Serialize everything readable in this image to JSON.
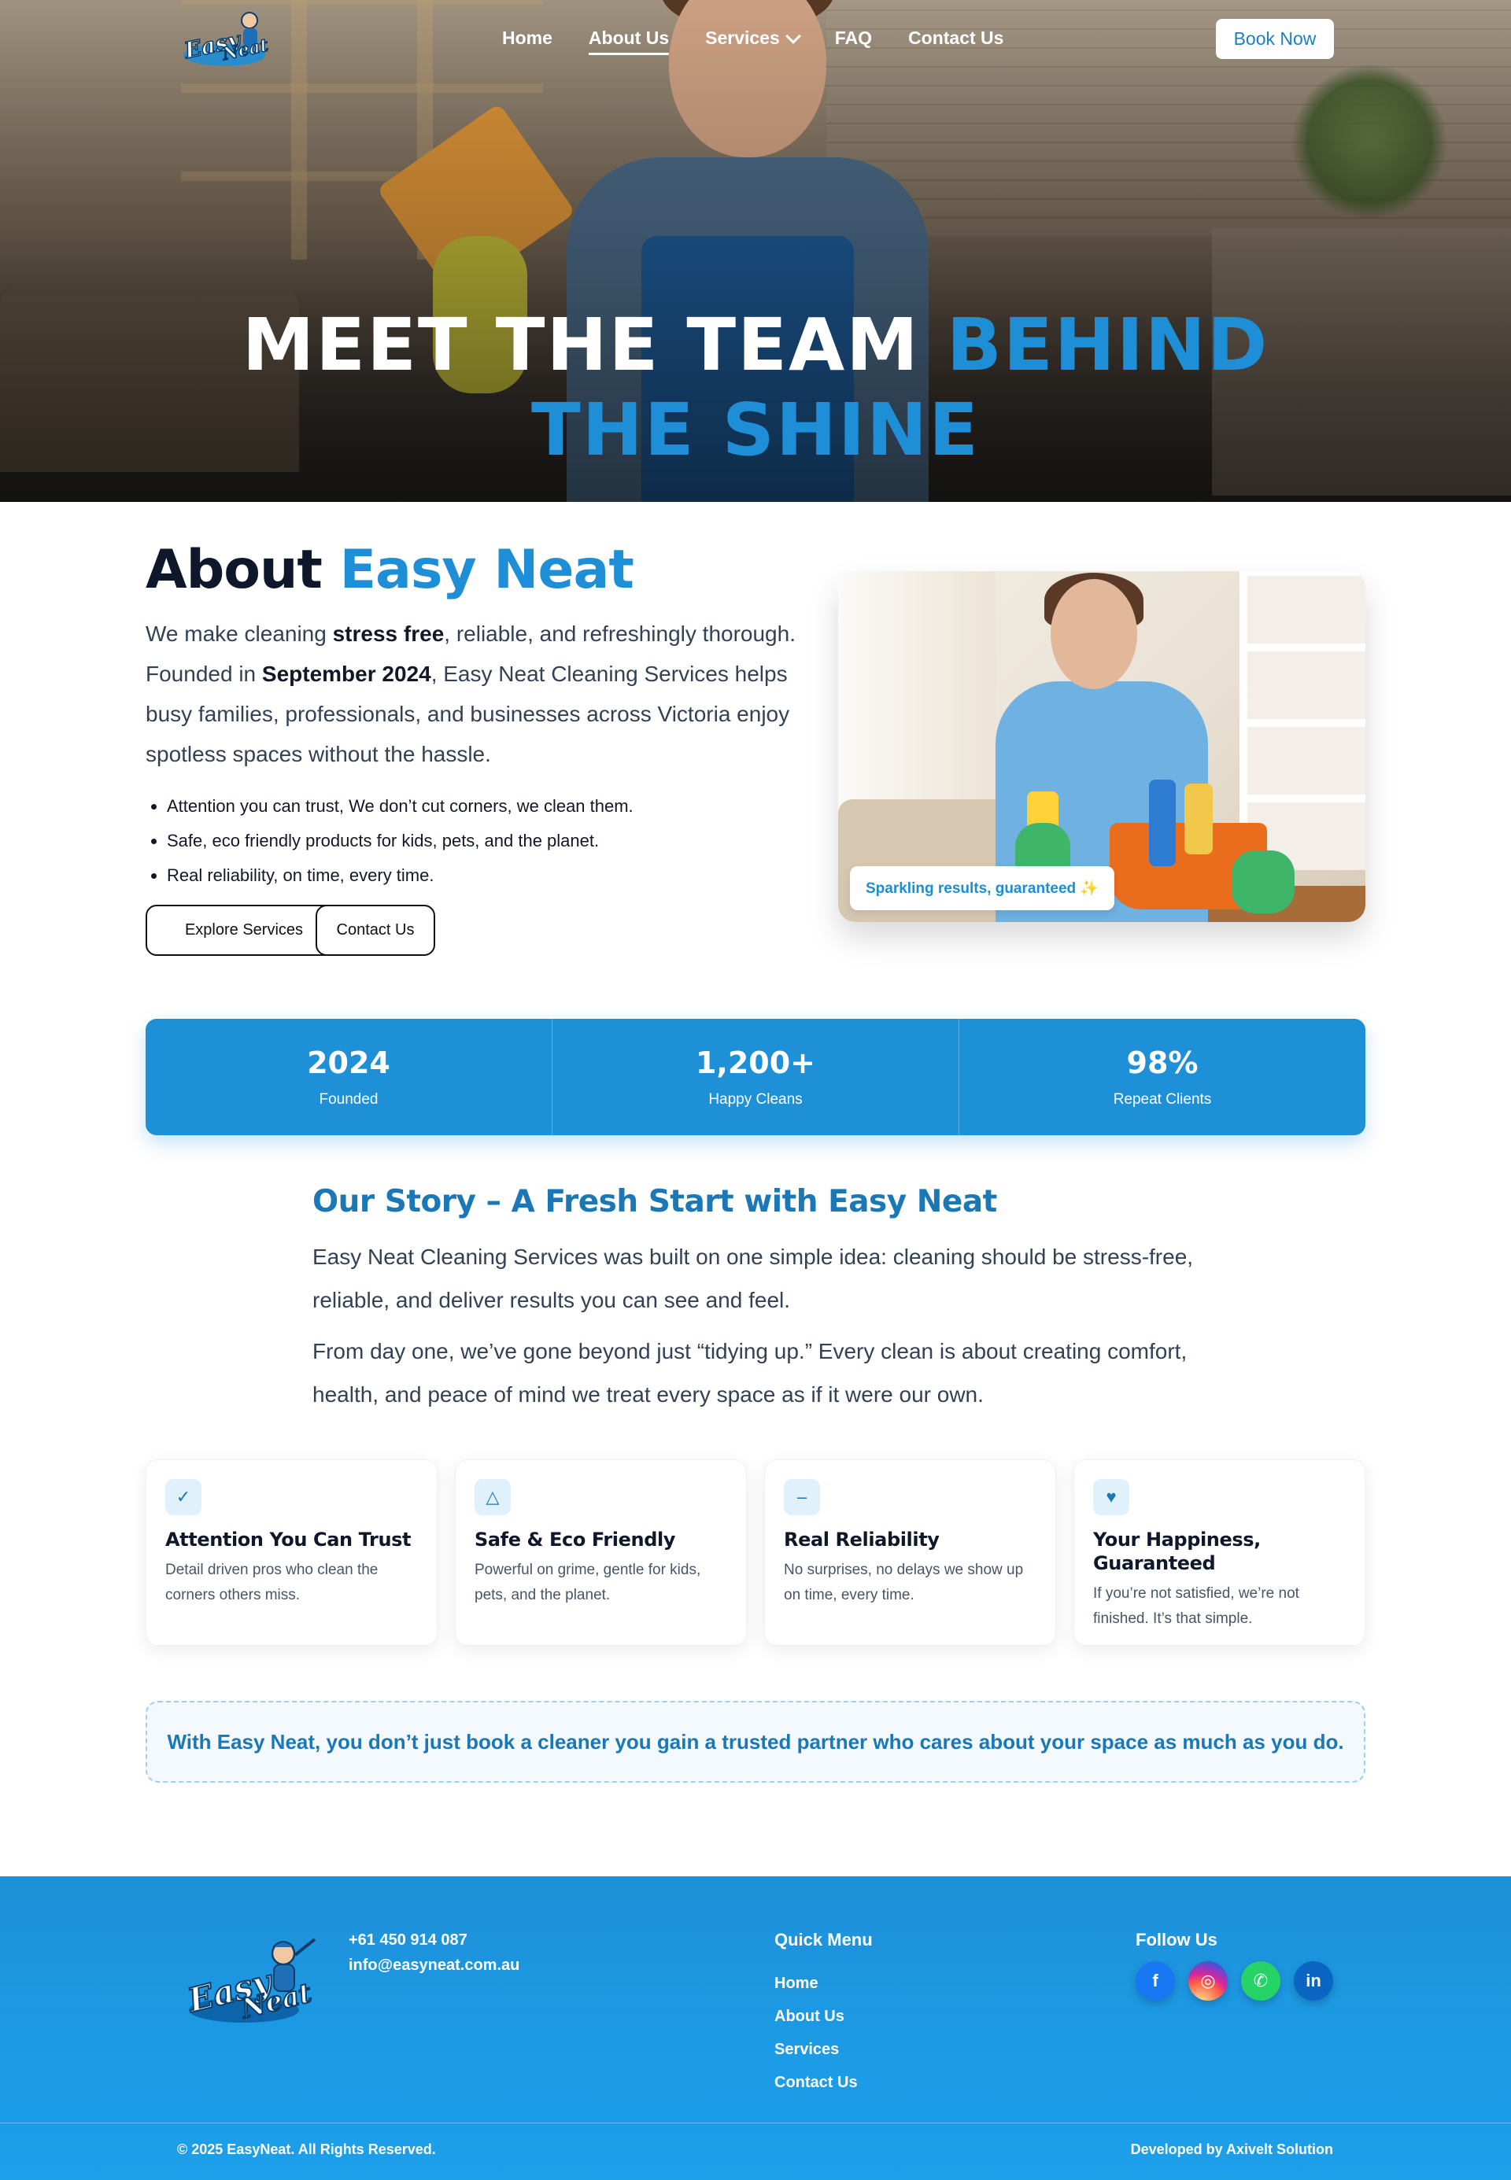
{
  "nav": {
    "logo_text": "Easy Neat",
    "links": [
      {
        "label": "Home"
      },
      {
        "label": "About Us"
      },
      {
        "label": "Services"
      },
      {
        "label": "FAQ"
      },
      {
        "label": "Contact Us"
      }
    ],
    "active": "About Us",
    "book_label": "Book Now"
  },
  "hero": {
    "title_main": "MEET THE TEAM ",
    "title_accent": "BEHIND THE SHINE"
  },
  "about": {
    "heading_main": "About ",
    "heading_accent": "Easy Neat",
    "para_1": "We make cleaning ",
    "para_bold_1": "stress free",
    "para_2": ", reliable, and refreshingly thorough. Founded in ",
    "para_bold_2": "September 2024",
    "para_3": ", Easy Neat Cleaning Services helps busy families, professionals, and businesses across Victoria enjoy spotless spaces without the hassle.",
    "bullets": [
      "Attention you can trust, We don’t cut corners, we clean them.",
      "Safe, eco friendly products for kids, pets, and the planet.",
      "Real reliability, on time, every time."
    ],
    "btn_explore": "Explore Services",
    "btn_contact": "Contact Us",
    "image_badge": "Sparkling results, guaranteed ✨"
  },
  "stats": [
    {
      "value": "2024",
      "label": "Founded"
    },
    {
      "value": "1,200+",
      "label": "Happy Cleans"
    },
    {
      "value": "98%",
      "label": "Repeat Clients"
    }
  ],
  "story": {
    "heading": "Our Story – A Fresh Start with Easy Neat",
    "para_1": "Easy Neat Cleaning Services was built on one simple idea: cleaning should be stress-free, reliable, and deliver results you can see and feel.",
    "para_2": "From day one, we’ve gone beyond just “tidying up.” Every clean is about creating comfort, health, and peace of mind we treat every space as if it were our own."
  },
  "features": [
    {
      "icon": "check-icon",
      "glyph": "✓",
      "title": "Attention You Can Trust",
      "desc": "Detail driven pros who clean the corners others miss."
    },
    {
      "icon": "triangle-icon",
      "glyph": "△",
      "title": "Safe & Eco Friendly",
      "desc": "Powerful on grime, gentle for kids, pets, and the planet."
    },
    {
      "icon": "minus-icon",
      "glyph": "–",
      "title": "Real Reliability",
      "desc": "No surprises, no delays we show up on time, every time."
    },
    {
      "icon": "heart-icon",
      "glyph": "♥",
      "title": "Your Happiness, Guaranteed",
      "desc": "If you’re not satisfied, we’re not finished. It’s that simple."
    }
  ],
  "callout": "With Easy Neat, you don’t just book a cleaner you gain a trusted partner who cares about your space as much as you do.",
  "footer": {
    "phone": "+61 450 914 087",
    "email": "info@easyneat.com.au",
    "menu_heading": "Quick Menu",
    "menu": [
      "Home",
      "About Us",
      "Services",
      "Contact Us"
    ],
    "follow_heading": "Follow Us",
    "socials": [
      {
        "icon": "facebook-icon",
        "glyph": "f"
      },
      {
        "icon": "instagram-icon",
        "glyph": "◎"
      },
      {
        "icon": "whatsapp-icon",
        "glyph": "✆"
      },
      {
        "icon": "linkedin-icon",
        "glyph": "in"
      }
    ],
    "copyright": "© 2025 EasyNeat. All Rights Reserved.",
    "developer": "Developed by Axivelt Solution"
  },
  "colors": {
    "brand_blue": "#1e90d7",
    "heading_blue": "#1a78b7",
    "dark_text": "#0f172a"
  }
}
